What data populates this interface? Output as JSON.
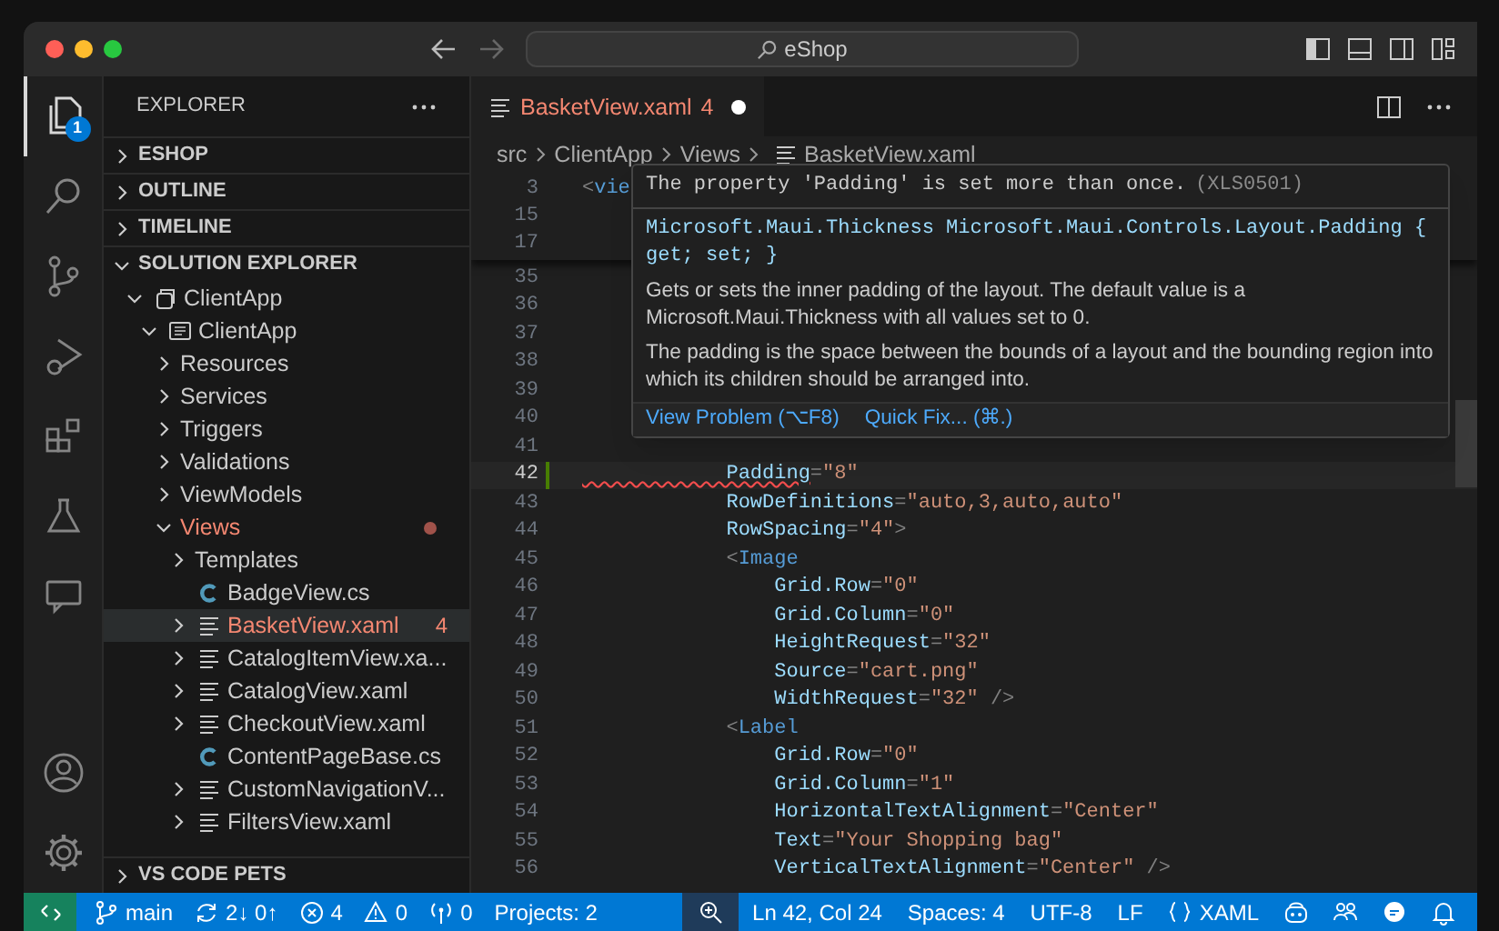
{
  "window": {
    "search": "eShop"
  },
  "activity_bar": {
    "top": [
      {
        "kind": "explorer",
        "selected": true,
        "badge": "1"
      },
      {
        "kind": "search",
        "selected": false
      },
      {
        "kind": "scm",
        "selected": false
      },
      {
        "kind": "debug",
        "selected": false
      },
      {
        "kind": "extensions",
        "selected": false
      },
      {
        "kind": "testing",
        "selected": false
      },
      {
        "kind": "chat",
        "selected": false
      }
    ],
    "bottom": [
      {
        "kind": "account"
      },
      {
        "kind": "settings"
      }
    ]
  },
  "sidebar": {
    "title": "EXPLORER",
    "sections": [
      {
        "label": "ESHOP",
        "expanded": false
      },
      {
        "label": "OUTLINE",
        "expanded": false
      },
      {
        "label": "TIMELINE",
        "expanded": false
      },
      {
        "label": "SOLUTION EXPLORER",
        "expanded": true
      }
    ],
    "tree": [
      {
        "label": "ClientApp",
        "kind": "solution",
        "expanded": true,
        "children": [
          {
            "label": "ClientApp",
            "kind": "project",
            "expanded": true,
            "children": [
              {
                "label": "Resources",
                "expanded": false,
                "problem": false,
                "selected": false
              },
              {
                "label": "Services",
                "expanded": false,
                "problem": false,
                "selected": false
              },
              {
                "label": "Triggers",
                "expanded": false,
                "problem": false,
                "selected": false
              },
              {
                "label": "Validations",
                "expanded": false,
                "problem": false,
                "selected": false
              },
              {
                "label": "ViewModels",
                "expanded": false,
                "problem": false,
                "selected": false
              },
              {
                "label": "Views",
                "expanded": true,
                "problem": true,
                "dot": true,
                "selected": false,
                "children": [
                  {
                    "label": "Templates",
                    "expanded": false,
                    "problem": false,
                    "selected": false
                  },
                  {
                    "label": "BadgeView.cs",
                    "kind": "cs",
                    "problem": false,
                    "selected": false
                  },
                  {
                    "label": "BasketView.xaml",
                    "kind": "xaml",
                    "expanded": false,
                    "problem": true,
                    "badge": "4",
                    "selected": true
                  },
                  {
                    "label": "CatalogItemView.xa...",
                    "kind": "xaml",
                    "expanded": false,
                    "problem": false,
                    "selected": false
                  },
                  {
                    "label": "CatalogView.xaml",
                    "kind": "xaml",
                    "expanded": false,
                    "problem": false,
                    "selected": false
                  },
                  {
                    "label": "CheckoutView.xaml",
                    "kind": "xaml",
                    "expanded": false,
                    "problem": false,
                    "selected": false
                  },
                  {
                    "label": "ContentPageBase.cs",
                    "kind": "cs",
                    "problem": false,
                    "selected": false
                  },
                  {
                    "label": "CustomNavigationV...",
                    "kind": "xaml",
                    "expanded": false,
                    "problem": false,
                    "selected": false
                  },
                  {
                    "label": "FiltersView.xaml",
                    "kind": "xaml",
                    "expanded": false,
                    "problem": false,
                    "selected": false
                  }
                ]
              }
            ]
          }
        ]
      }
    ],
    "bottom_section": {
      "label": "VS CODE PETS",
      "expanded": false
    }
  },
  "tabs": [
    {
      "label": "BasketView.xaml",
      "problem": true,
      "badge": "4",
      "modified": true,
      "selected": true
    }
  ],
  "breadcrumb": [
    "src",
    "ClientApp",
    "Views",
    "BasketView.xaml"
  ],
  "sticky_lines": [
    {
      "number": "3",
      "tokens": [
        {
          "kind": "punct",
          "text": "<"
        },
        {
          "kind": "tag",
          "text": "vie"
        }
      ]
    },
    {
      "number": "15"
    },
    {
      "number": "17"
    }
  ],
  "lines": [
    {
      "number": "35",
      "current": false,
      "modified": false
    },
    {
      "number": "36",
      "current": false,
      "modified": false
    },
    {
      "number": "37",
      "current": false,
      "modified": false
    },
    {
      "number": "38",
      "current": false,
      "modified": false
    },
    {
      "number": "39",
      "current": false,
      "modified": false
    },
    {
      "number": "40",
      "current": false,
      "modified": false
    },
    {
      "number": "41",
      "current": false,
      "modified": false
    },
    {
      "number": "42",
      "current": true,
      "modified": true,
      "tokens": [
        {
          "kind": "attr",
          "text": "            Padding",
          "error": true
        },
        {
          "kind": "punct",
          "text": "="
        },
        {
          "kind": "string",
          "text": "\"8\""
        }
      ]
    },
    {
      "number": "43",
      "current": false,
      "modified": false,
      "tokens": [
        {
          "kind": "attr",
          "text": "            RowDefinitions"
        },
        {
          "kind": "punct",
          "text": "="
        },
        {
          "kind": "string",
          "text": "\"auto,3,auto,auto\""
        }
      ]
    },
    {
      "number": "44",
      "current": false,
      "modified": false,
      "tokens": [
        {
          "kind": "attr",
          "text": "            RowSpacing"
        },
        {
          "kind": "punct",
          "text": "="
        },
        {
          "kind": "string",
          "text": "\"4\""
        },
        {
          "kind": "punct",
          "text": ">"
        }
      ]
    },
    {
      "number": "45",
      "current": false,
      "modified": false,
      "tokens": [
        {
          "kind": "punct",
          "text": "            <"
        },
        {
          "kind": "tag",
          "text": "Image"
        }
      ]
    },
    {
      "number": "46",
      "current": false,
      "modified": false,
      "tokens": [
        {
          "kind": "attr",
          "text": "                Grid.Row"
        },
        {
          "kind": "punct",
          "text": "="
        },
        {
          "kind": "string",
          "text": "\"0\""
        }
      ]
    },
    {
      "number": "47",
      "current": false,
      "modified": false,
      "tokens": [
        {
          "kind": "attr",
          "text": "                Grid.Column"
        },
        {
          "kind": "punct",
          "text": "="
        },
        {
          "kind": "string",
          "text": "\"0\""
        }
      ]
    },
    {
      "number": "48",
      "current": false,
      "modified": false,
      "tokens": [
        {
          "kind": "attr",
          "text": "                HeightRequest"
        },
        {
          "kind": "punct",
          "text": "="
        },
        {
          "kind": "string",
          "text": "\"32\""
        }
      ]
    },
    {
      "number": "49",
      "current": false,
      "modified": false,
      "tokens": [
        {
          "kind": "attr",
          "text": "                Source"
        },
        {
          "kind": "punct",
          "text": "="
        },
        {
          "kind": "string",
          "text": "\"cart.png\""
        }
      ]
    },
    {
      "number": "50",
      "current": false,
      "modified": false,
      "tokens": [
        {
          "kind": "attr",
          "text": "                WidthRequest"
        },
        {
          "kind": "punct",
          "text": "="
        },
        {
          "kind": "string",
          "text": "\"32\""
        },
        {
          "kind": "punct",
          "text": " />"
        }
      ]
    },
    {
      "number": "51",
      "current": false,
      "modified": false,
      "tokens": [
        {
          "kind": "punct",
          "text": "            <"
        },
        {
          "kind": "tag",
          "text": "Label"
        }
      ]
    },
    {
      "number": "52",
      "current": false,
      "modified": false,
      "tokens": [
        {
          "kind": "attr",
          "text": "                Grid.Row"
        },
        {
          "kind": "punct",
          "text": "="
        },
        {
          "kind": "string",
          "text": "\"0\""
        }
      ]
    },
    {
      "number": "53",
      "current": false,
      "modified": false,
      "tokens": [
        {
          "kind": "attr",
          "text": "                Grid.Column"
        },
        {
          "kind": "punct",
          "text": "="
        },
        {
          "kind": "string",
          "text": "\"1\""
        }
      ]
    },
    {
      "number": "54",
      "current": false,
      "modified": false,
      "tokens": [
        {
          "kind": "attr",
          "text": "                HorizontalTextAlignment"
        },
        {
          "kind": "punct",
          "text": "="
        },
        {
          "kind": "string",
          "text": "\"Center\""
        }
      ]
    },
    {
      "number": "55",
      "current": false,
      "modified": false,
      "tokens": [
        {
          "kind": "attr",
          "text": "                Text"
        },
        {
          "kind": "punct",
          "text": "="
        },
        {
          "kind": "string",
          "text": "\"Your Shopping bag\""
        }
      ]
    },
    {
      "number": "56",
      "current": false,
      "modified": false,
      "tokens": [
        {
          "kind": "attr",
          "text": "                VerticalTextAlignment"
        },
        {
          "kind": "punct",
          "text": "="
        },
        {
          "kind": "string",
          "text": "\"Center\""
        },
        {
          "kind": "punct",
          "text": " />"
        }
      ]
    }
  ],
  "hover": {
    "message": "The property 'Padding' is set more than once.",
    "code": "(XLS0501)",
    "signature": "Microsoft.Maui.Thickness Microsoft.Maui.Controls.Layout.Padding { get; set; }",
    "paragraphs": [
      "Gets or sets the inner padding of the layout. The default value is a Microsoft.Maui.Thickness with all values set to 0.",
      "The padding is the space between the bounds of a layout and the bounding region into which its children should be arranged into."
    ],
    "actions": [
      "View Problem (⌥F8)",
      "Quick Fix... (⌘.)"
    ]
  },
  "status_bar": {
    "left": [
      {
        "kind": "branch",
        "text": "main"
      },
      {
        "kind": "sync",
        "text": "2↓ 0↑"
      },
      {
        "kind": "error",
        "text": "4"
      },
      {
        "kind": "warning",
        "text": "0"
      },
      {
        "kind": "ports",
        "text": "0"
      },
      {
        "kind": "plain",
        "text": "Projects: 2"
      }
    ],
    "right": [
      {
        "kind": "zoom"
      },
      {
        "kind": "plain",
        "text": "Ln 42, Col 24"
      },
      {
        "kind": "plain",
        "text": "Spaces: 4"
      },
      {
        "kind": "plain",
        "text": "UTF-8"
      },
      {
        "kind": "plain",
        "text": "LF"
      },
      {
        "kind": "braces",
        "text": "XAML"
      },
      {
        "kind": "copilot"
      },
      {
        "kind": "accounts"
      },
      {
        "kind": "feedback"
      },
      {
        "kind": "bell"
      }
    ]
  }
}
